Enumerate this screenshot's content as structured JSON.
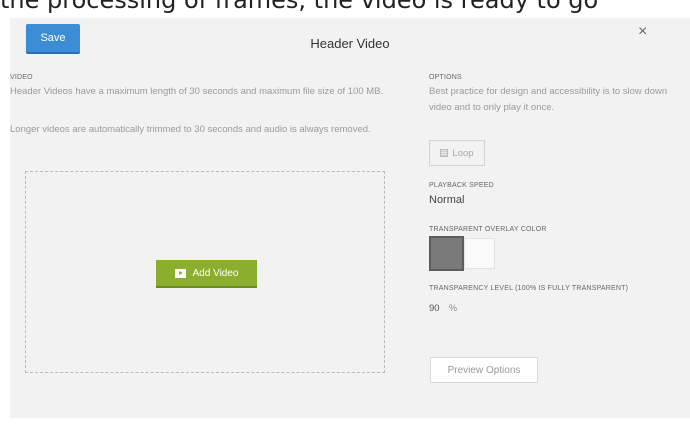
{
  "top_strip": {
    "text": "the processing of frames, the video is ready to go"
  },
  "modal": {
    "save_label": "Save",
    "title": "Header Video",
    "close_glyph": "×"
  },
  "video": {
    "label": "VIDEO",
    "desc1": "Header Videos have a maximum length of 30 seconds and maximum file size of 100 MB.",
    "desc2": "Longer videos are automatically trimmed to 30 seconds and audio is always removed.",
    "add_label": "Add Video"
  },
  "options": {
    "label": "OPTIONS",
    "desc": "Best practice for design and accessibility is to slow down video and to only play it once.",
    "loop_label": "Loop",
    "loop_checked": false,
    "speed_label": "PLAYBACK SPEED",
    "speed_value": "Normal",
    "overlay_label": "TRANSPARENT OVERLAY COLOR",
    "overlay_colors": [
      "#7a7a7a",
      "#f9f9f9"
    ],
    "overlay_selected": "#7a7a7a",
    "transparency_label": "TRANSPARENCY LEVEL (100% IS FULLY TRANSPARENT)",
    "transparency_value": "90",
    "transparency_unit": "%",
    "preview_label": "Preview Options"
  },
  "colors": {
    "save": "#3b8ed6",
    "add_video": "#8cae2e"
  }
}
